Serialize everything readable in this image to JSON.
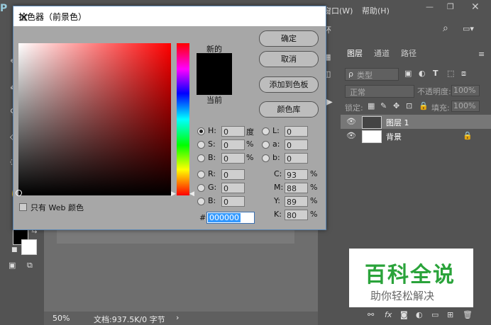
{
  "menu": {
    "window": "窗口(W)",
    "help": "帮助(H)"
  },
  "options": {
    "search_icon": "search-icon"
  },
  "status": {
    "zoom": "50%",
    "doc_size": "文档:937.5K/0 字节"
  },
  "dialog": {
    "title": "拾色器（前景色）",
    "new_label": "新的",
    "current_label": "当前",
    "buttons": {
      "ok": "确定",
      "cancel": "取消",
      "add": "添加到色板",
      "library": "颜色库"
    },
    "web_only": "只有 Web 颜色",
    "hsb": [
      {
        "label": "H:",
        "value": "0",
        "unit": "度"
      },
      {
        "label": "S:",
        "value": "0",
        "unit": "%"
      },
      {
        "label": "B:",
        "value": "0",
        "unit": "%"
      }
    ],
    "rgb": [
      {
        "label": "R:",
        "value": "0"
      },
      {
        "label": "G:",
        "value": "0"
      },
      {
        "label": "B:",
        "value": "0"
      }
    ],
    "lab": [
      {
        "label": "L:",
        "value": "0"
      },
      {
        "label": "a:",
        "value": "0"
      },
      {
        "label": "b:",
        "value": "0"
      }
    ],
    "cmyk": [
      {
        "label": "C:",
        "value": "93",
        "unit": "%"
      },
      {
        "label": "M:",
        "value": "88",
        "unit": "%"
      },
      {
        "label": "Y:",
        "value": "89",
        "unit": "%"
      },
      {
        "label": "K:",
        "value": "80",
        "unit": "%"
      }
    ],
    "hex_label": "#",
    "hex": "000000",
    "new_color": "#000000",
    "current_color": "#000000"
  },
  "layers_panel": {
    "tabs": [
      "图层",
      "通道",
      "路径"
    ],
    "filter": "类型",
    "blend_mode": "正常",
    "opacity_label": "不透明度:",
    "opacity": "100%",
    "lock_label": "锁定:",
    "fill_label": "填充:",
    "fill": "100%",
    "layers": [
      {
        "name": "图层 1",
        "selected": true
      },
      {
        "name": "背景",
        "selected": false
      }
    ]
  },
  "watermark": {
    "title": "百科全说",
    "subtitle": "助你轻松解决"
  }
}
